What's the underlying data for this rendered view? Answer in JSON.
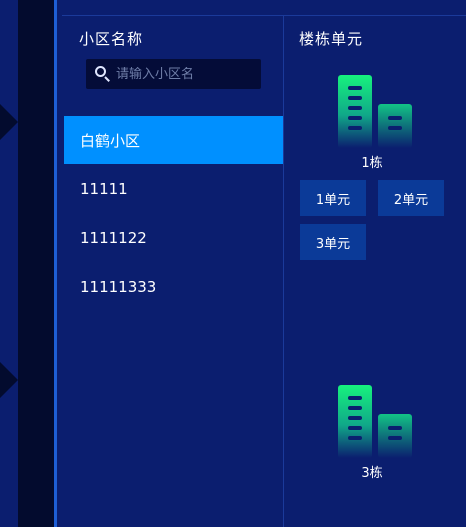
{
  "community_panel": {
    "title": "小区名称",
    "search": {
      "placeholder": "请输入小区名",
      "value": ""
    },
    "items": [
      {
        "label": "白鹤小区",
        "active": true
      },
      {
        "label": "11111",
        "active": false
      },
      {
        "label": "1111122",
        "active": false
      },
      {
        "label": "11111333",
        "active": false
      }
    ]
  },
  "building_panel": {
    "title": "楼栋单元",
    "buildings": [
      {
        "label": "1栋",
        "icon": "building-icon",
        "units": [
          "1单元",
          "2单元",
          "3单元"
        ]
      },
      {
        "label": "3栋",
        "icon": "building-icon",
        "units": []
      }
    ]
  },
  "colors": {
    "background": "#0b1e6f",
    "active_item": "#0090ff",
    "unit_button": "#0b3a98",
    "building_gradient_top": "#17f27d",
    "building_gradient_bottom": "#0b1e6f"
  }
}
